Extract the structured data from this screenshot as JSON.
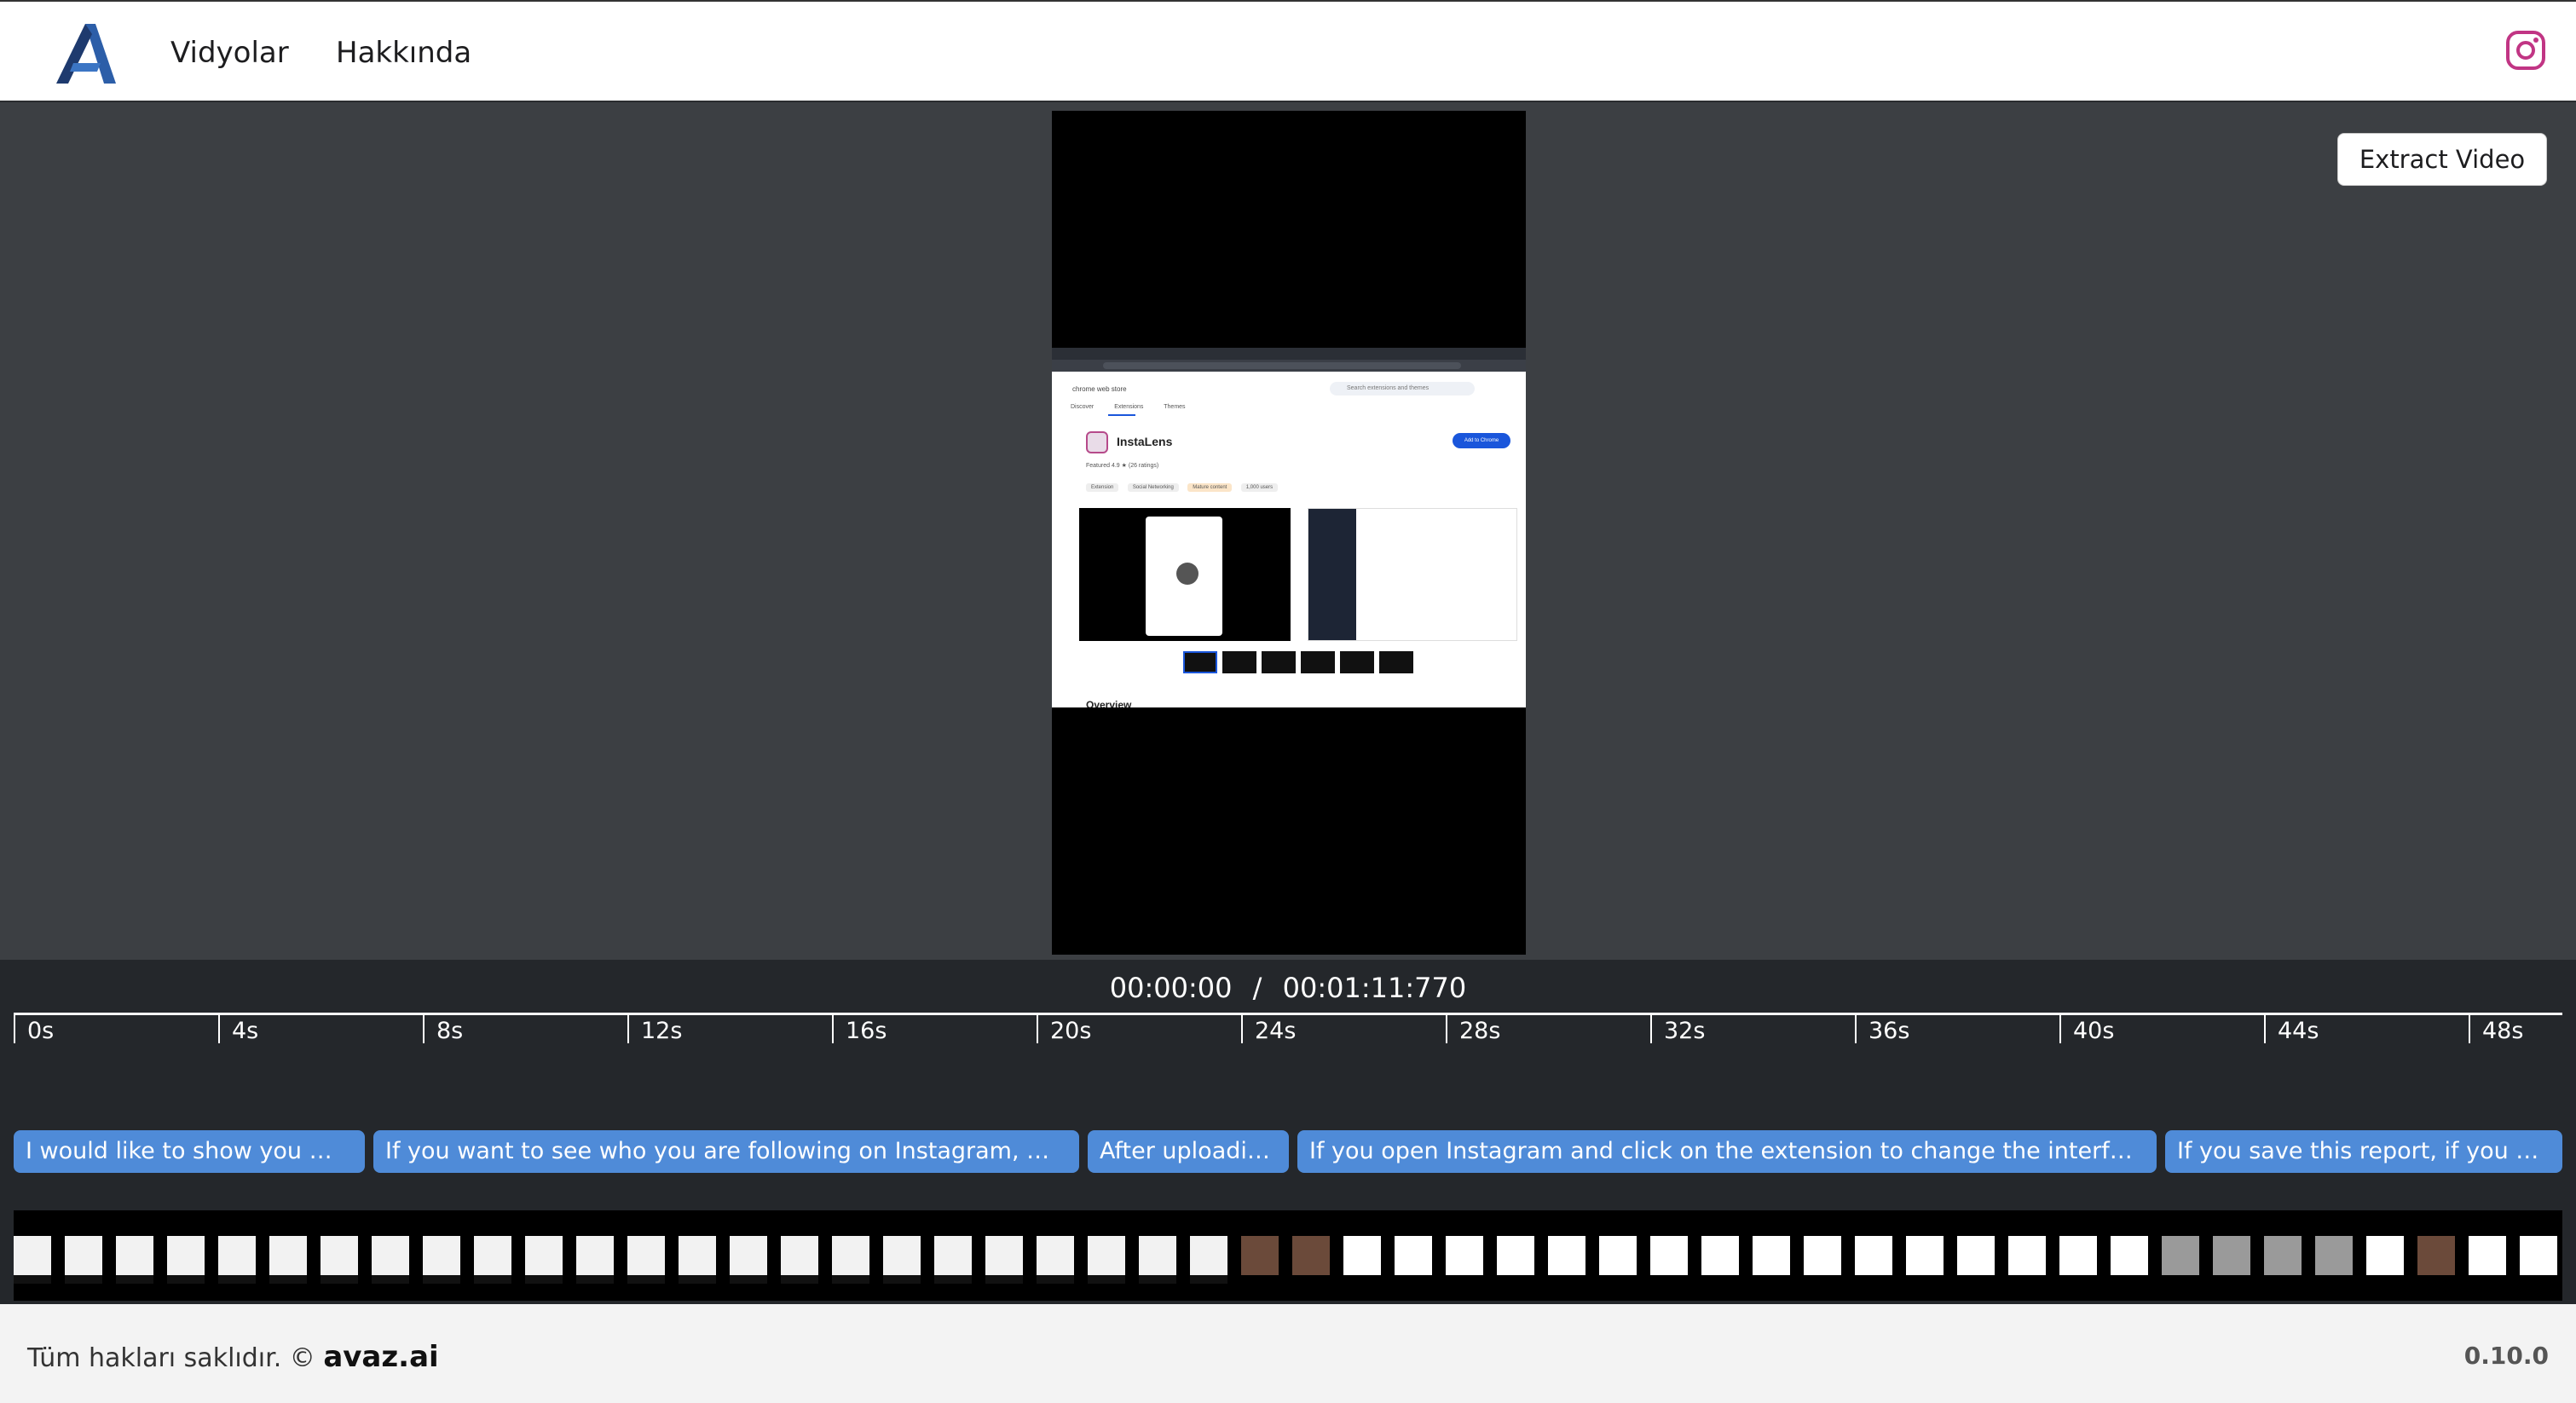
{
  "header": {
    "nav": [
      "Vidyolar",
      "Hakkında"
    ],
    "logo_icon": "avaz-logo-icon",
    "social_icon": "instagram-icon",
    "colors": {
      "instagram": "#c13584",
      "logo": "#1e3a6e"
    }
  },
  "main": {
    "extract_label": "Extract Video",
    "video": {
      "store_name": "chrome web store",
      "search_placeholder": "Search extensions and themes",
      "tabs": [
        "Discover",
        "Extensions",
        "Themes"
      ],
      "extension_name": "InstaLens",
      "add_button": "Add to Chrome",
      "meta": "Featured  4.9 ★ (26 ratings)",
      "chips": [
        "Extension",
        "Social Networking",
        "Mature content",
        "1,000 users"
      ],
      "section_heading": "Overview"
    }
  },
  "timeline": {
    "current_time": "00:00:00",
    "separator": "/",
    "total_time": "00:01:11:770",
    "ticks": [
      "0s",
      "4s",
      "8s",
      "12s",
      "16s",
      "20s",
      "24s",
      "28s",
      "32s",
      "36s",
      "40s",
      "44s",
      "48s"
    ],
    "subtitles": [
      "I would like to show you my ...",
      "If you want to see who you are following on Instagram, who is...",
      "After uploadin...",
      "If you open Instagram and click on the extension to change the interface, y...",
      "If you save this report, if you compa"
    ],
    "colors": {
      "subtitle": "#4f8bd8"
    }
  },
  "footer": {
    "copyright": "Tüm hakları saklıdır. ©",
    "brand": "avaz.ai",
    "version": "0.10.0"
  }
}
